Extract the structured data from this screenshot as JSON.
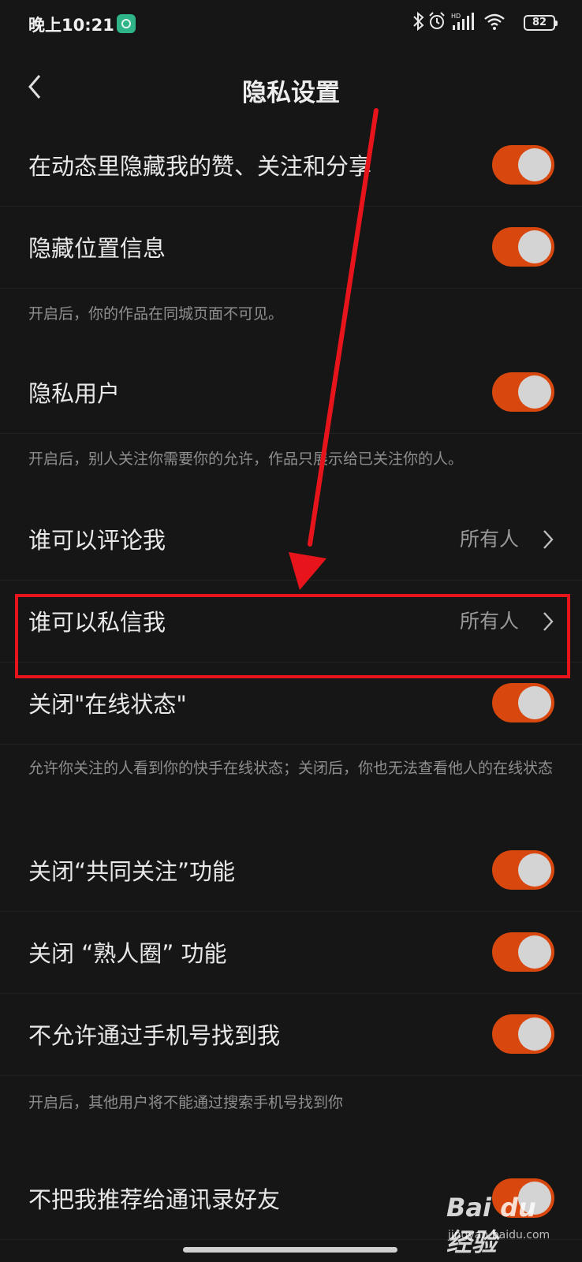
{
  "status_bar": {
    "time": "晚上10:21",
    "battery": "82",
    "icons": [
      "app-notification-icon",
      "bluetooth-icon",
      "alarm-icon",
      "hd-signal-icon",
      "wifi-icon",
      "battery-icon"
    ]
  },
  "nav": {
    "title": "隐私设置",
    "back_icon": "chevron-left-icon"
  },
  "settings": [
    {
      "label": "在动态里隐藏我的赞、关注和分享",
      "type": "toggle",
      "on": true
    },
    {
      "label": "隐藏位置信息",
      "type": "toggle",
      "on": true
    },
    {
      "note": "开启后，你的作品在同城页面不可见。"
    },
    {
      "label": "隐私用户",
      "type": "toggle",
      "on": true
    },
    {
      "note": "开启后，别人关注你需要你的允许，作品只展示给已关注你的人。"
    },
    {
      "label": "谁可以评论我",
      "type": "select",
      "value": "所有人"
    },
    {
      "label": "谁可以私信我",
      "type": "select",
      "value": "所有人",
      "highlighted": true
    },
    {
      "label": "关闭\"在线状态\"",
      "type": "toggle",
      "on": true
    },
    {
      "note": "允许你关注的人看到你的快手在线状态；关闭后，你也无法查看他人的在线状态"
    },
    {
      "label": "关闭“共同关注”功能",
      "type": "toggle",
      "on": true
    },
    {
      "label": "关闭 “熟人圈” 功能",
      "type": "toggle",
      "on": true
    },
    {
      "label": "不允许通过手机号找到我",
      "type": "toggle",
      "on": true
    },
    {
      "note": "开启后，其他用户将不能通过搜索手机号找到你"
    },
    {
      "label": "不把我推荐给通讯录好友",
      "type": "toggle",
      "on": true
    }
  ],
  "watermark": {
    "main": "Bai du 经验",
    "sub": "jingyan.baidu.com"
  },
  "colors": {
    "accent": "#d8470d",
    "background": "#161616",
    "annotation": "#e8141c"
  }
}
